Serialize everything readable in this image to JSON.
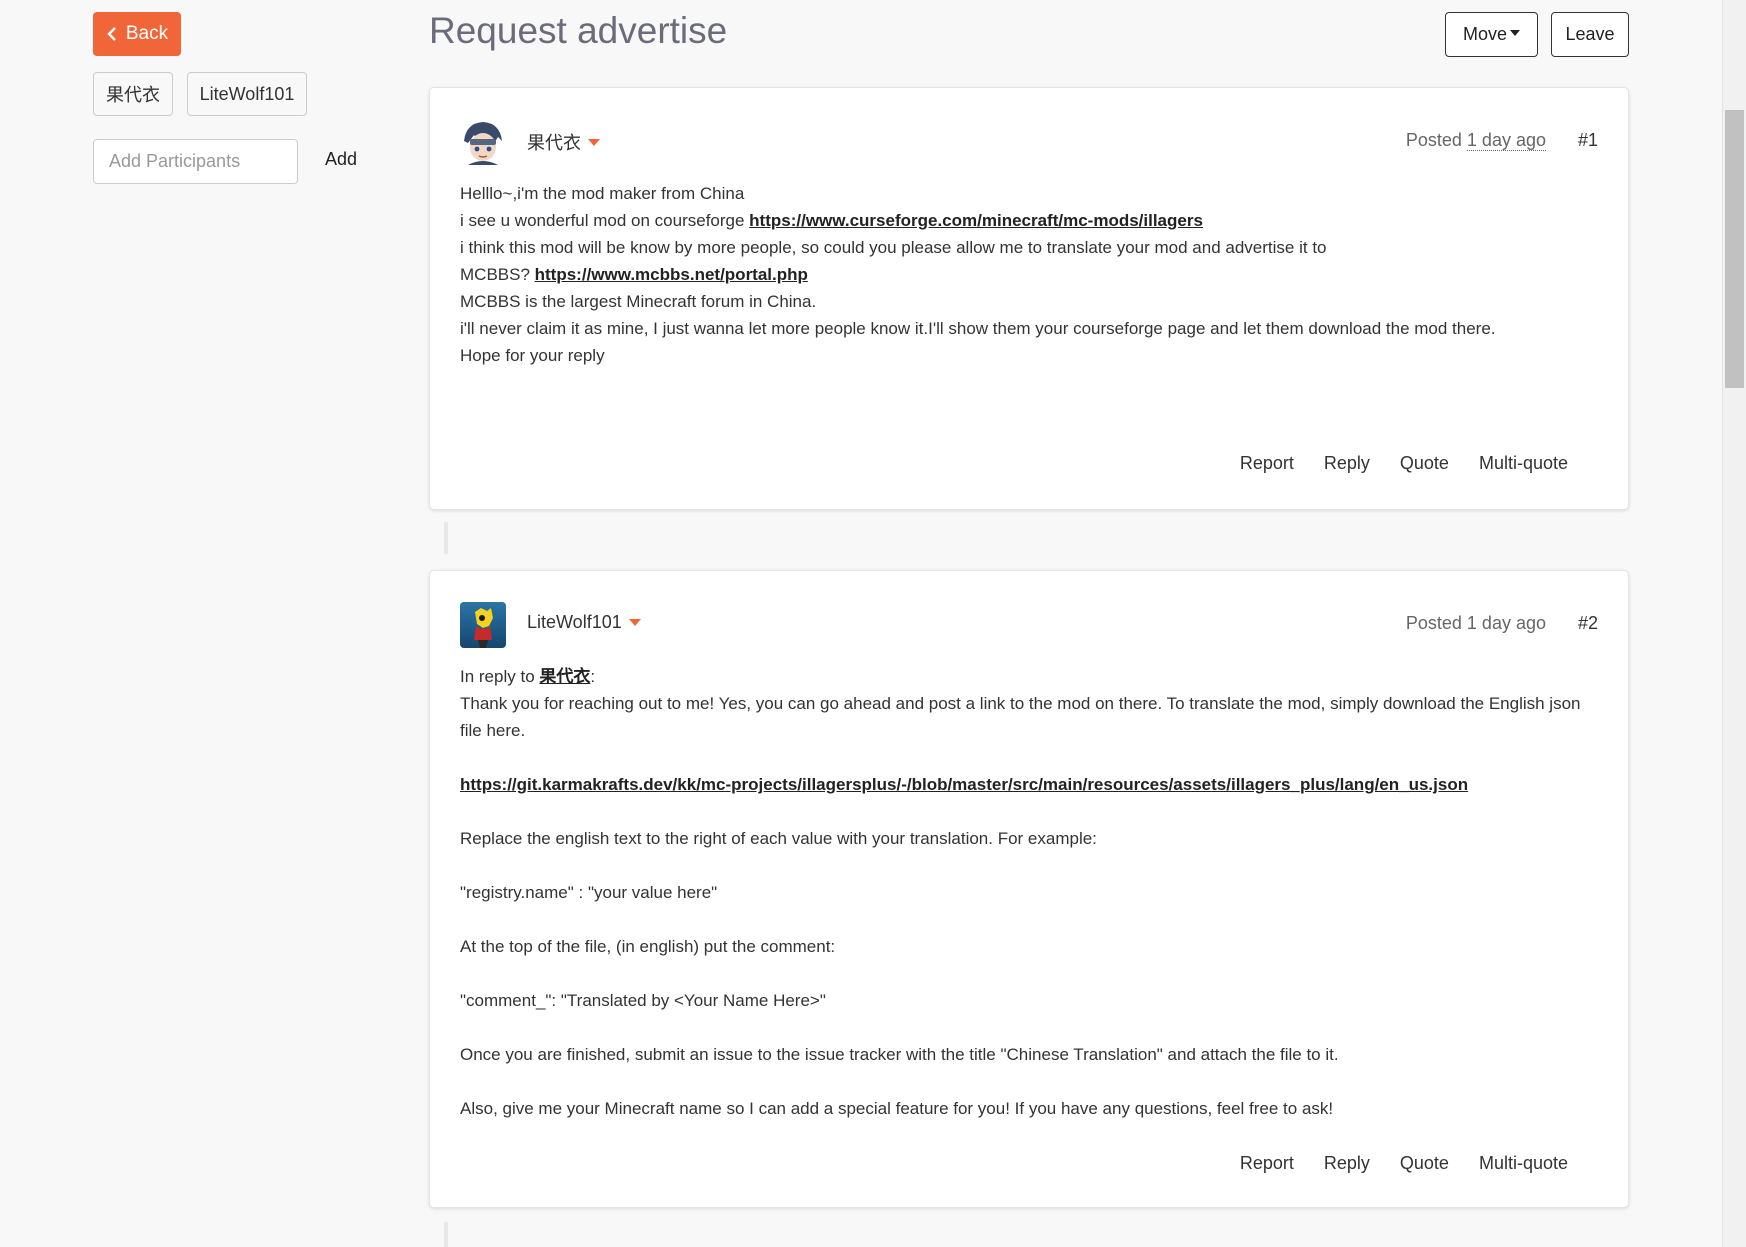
{
  "sidebar": {
    "back_label": "Back",
    "participants": [
      "果代衣",
      "LiteWolf101"
    ],
    "add_placeholder": "Add Participants",
    "add_label": "Add"
  },
  "header": {
    "title": "Request advertise",
    "move_label": "Move",
    "leave_label": "Leave"
  },
  "colors": {
    "accent": "#f06639",
    "title": "#6b6b7b"
  },
  "posts": [
    {
      "author": "果代衣",
      "posted_prefix": "Posted",
      "posted_ago": "1 day ago",
      "number": "#1",
      "lines": {
        "l1": "Helllo~,i'm the mod maker from China",
        "l2_text": "i see u wonderful mod on courseforge ",
        "l2_link": "https://www.curseforge.com/minecraft/mc-mods/illagers",
        "l3": "i think this mod will be know by more people, so could you please allow me to translate your mod and advertise it to",
        "l4_text": "MCBBS? ",
        "l4_link": "https://www.mcbbs.net/portal.php",
        "l5": "MCBBS is the largest Minecraft forum in China.",
        "l6": "i'll never claim it as mine, I just wanna let more people know it.I'll show them your courseforge page and let them download the mod there.",
        "l7": "Hope for your reply"
      },
      "actions": {
        "report": "Report",
        "reply": "Reply",
        "quote": "Quote",
        "multiquote": "Multi-quote"
      }
    },
    {
      "author": "LiteWolf101",
      "posted_prefix": "Posted",
      "posted_ago": "1 day ago",
      "number": "#2",
      "lines": {
        "reply_prefix": "In reply to ",
        "reply_user": "果代衣",
        "reply_colon": ":",
        "l1": " Thank you for reaching out to me! Yes, you can go ahead and post a link to the mod on there. To translate the mod, simply download the English json file here.",
        "link": "https://git.karmakrafts.dev/kk/mc-projects/illagersplus/-/blob/master/src/main/resources/assets/illagers_plus/lang/en_us.json",
        "l2": "Replace the english text to the right of each value with your translation. For example:",
        "l3": " \"registry.name\" : \"your value here\"",
        "l4": "At the top of the file, (in english) put the comment:",
        "l5": "\"comment_\": \"Translated by <Your Name Here>\"",
        "l6": "Once you are finished, submit an issue to the issue tracker with the title \"Chinese Translation\" and attach the file to it.",
        "l7": "Also, give me your Minecraft name so I can add a special feature for you! If you have any questions, feel free to ask!"
      },
      "actions": {
        "report": "Report",
        "reply": "Reply",
        "quote": "Quote",
        "multiquote": "Multi-quote"
      }
    }
  ]
}
